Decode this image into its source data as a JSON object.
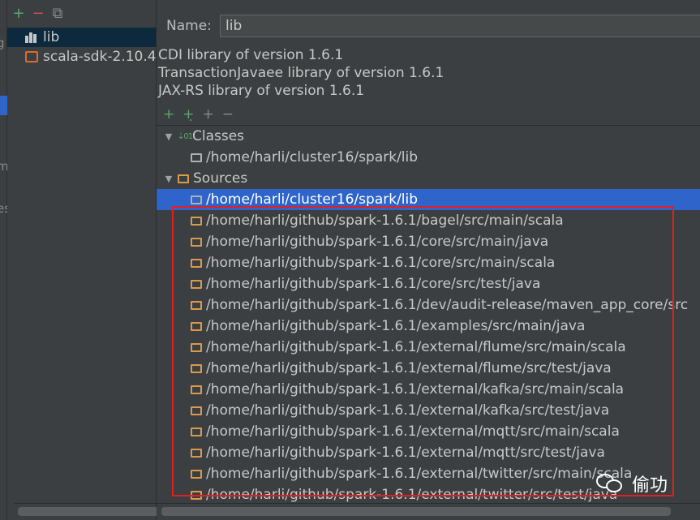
{
  "left_panel": {
    "toolbar": {
      "add_icon": "plus-icon",
      "remove_icon": "minus-icon",
      "copy_icon": "copy-icon"
    },
    "libraries": [
      {
        "label": "lib",
        "icon": "library-bars-icon",
        "selected": true
      },
      {
        "label": "scala-sdk-2.10.4",
        "icon": "scala-sdk-icon",
        "selected": false
      }
    ]
  },
  "details": {
    "name_label": "Name:",
    "name_value": "lib",
    "descriptions": [
      "CDI library of version 1.6.1",
      "TransactionJavaee library of version 1.6.1",
      "JAX-RS library of version 1.6.1"
    ],
    "tree_toolbar": {
      "add_icon": "plus-icon",
      "add_alt_icon": "add-to-library-icon",
      "attach_icon": "attach-files-icon",
      "remove_icon": "minus-icon"
    }
  },
  "tree": {
    "classes_label": "Classes",
    "classes_items": [
      "/home/harli/cluster16/spark/lib"
    ],
    "sources_label": "Sources",
    "sources_selected": "/home/harli/cluster16/spark/lib",
    "sources_items": [
      "/home/harli/github/spark-1.6.1/bagel/src/main/scala",
      "/home/harli/github/spark-1.6.1/core/src/main/java",
      "/home/harli/github/spark-1.6.1/core/src/main/scala",
      "/home/harli/github/spark-1.6.1/core/src/test/java",
      "/home/harli/github/spark-1.6.1/dev/audit-release/maven_app_core/src",
      "/home/harli/github/spark-1.6.1/examples/src/main/java",
      "/home/harli/github/spark-1.6.1/external/flume/src/main/scala",
      "/home/harli/github/spark-1.6.1/external/flume/src/test/java",
      "/home/harli/github/spark-1.6.1/external/kafka/src/main/scala",
      "/home/harli/github/spark-1.6.1/external/kafka/src/test/java",
      "/home/harli/github/spark-1.6.1/external/mqtt/src/main/scala",
      "/home/harli/github/spark-1.6.1/external/mqtt/src/test/java",
      "/home/harli/github/spark-1.6.1/external/twitter/src/main/scala",
      "/home/harli/github/spark-1.6.1/external/twitter/src/test/java"
    ]
  },
  "edge_marks": [
    "g",
    "m",
    "es"
  ],
  "watermark": {
    "text": "偷功",
    "icon": "wechat-icon"
  },
  "colors": {
    "background": "#3c3f41",
    "selection": "#2f65ca",
    "highlight_box": "#e02020",
    "folder": "#d99a4e"
  }
}
